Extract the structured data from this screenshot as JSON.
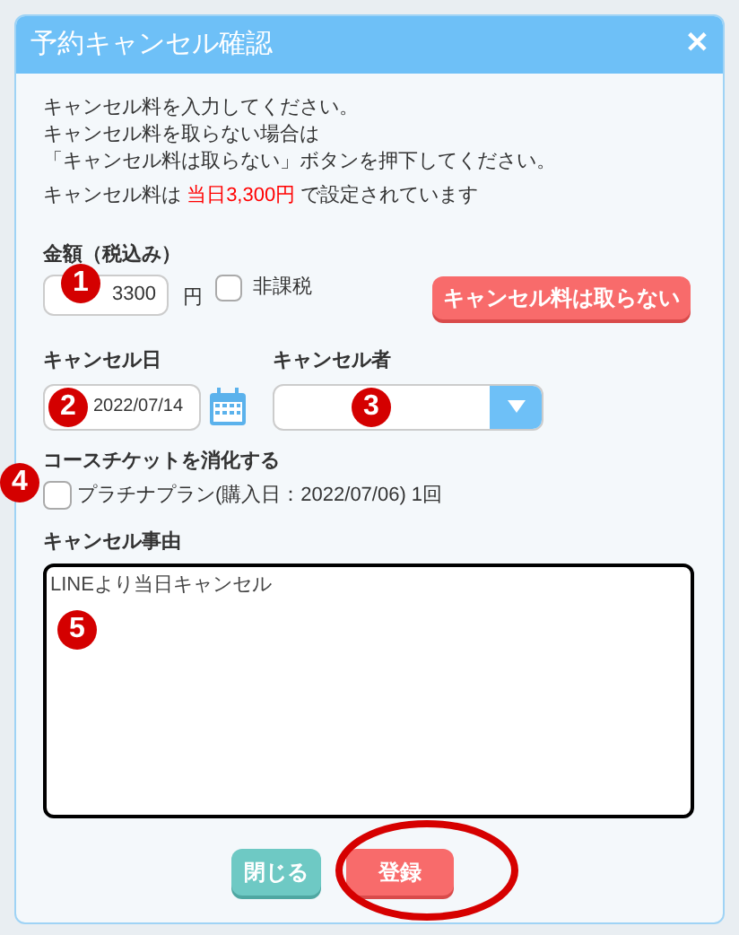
{
  "dialog": {
    "title": "予約キャンセル確認",
    "close": "✕"
  },
  "instructions": [
    "キャンセル料を入力してください。",
    "キャンセル料を取らない場合は",
    "「キャンセル料は取らない」ボタンを押下してください。"
  ],
  "fee_note": "キャンセル料は **当日3,300円** で設定されています",
  "amount": {
    "label": "金額（税込み）",
    "value": "3300",
    "unit": "円",
    "tax_exempt": {
      "label": "非課税",
      "checked": false
    }
  },
  "no_fee_button": "キャンセル料は取らない",
  "cancel_date": {
    "label": "キャンセル日",
    "value": "2022/07/14"
  },
  "canceled_by": {
    "label": "キャンセル者"
  },
  "course_ticket": {
    "label": "コースチケットを消化する",
    "option": {
      "label": "プラチナプラン(購入日：2022/07/06) 1回",
      "checked": false
    }
  },
  "reason": {
    "label": "キャンセル事由",
    "value": "LINEより当日キャンセル"
  },
  "buttons": [
    {
      "label": "閉じる",
      "kind": "secondary"
    },
    {
      "label": "登録",
      "kind": "primary"
    }
  ],
  "annotations": [
    {
      "label": "1"
    },
    {
      "label": "2"
    },
    {
      "label": "3"
    },
    {
      "label": "4"
    },
    {
      "label": "5"
    }
  ],
  "highlight": {
    "kind": "ring"
  }
}
